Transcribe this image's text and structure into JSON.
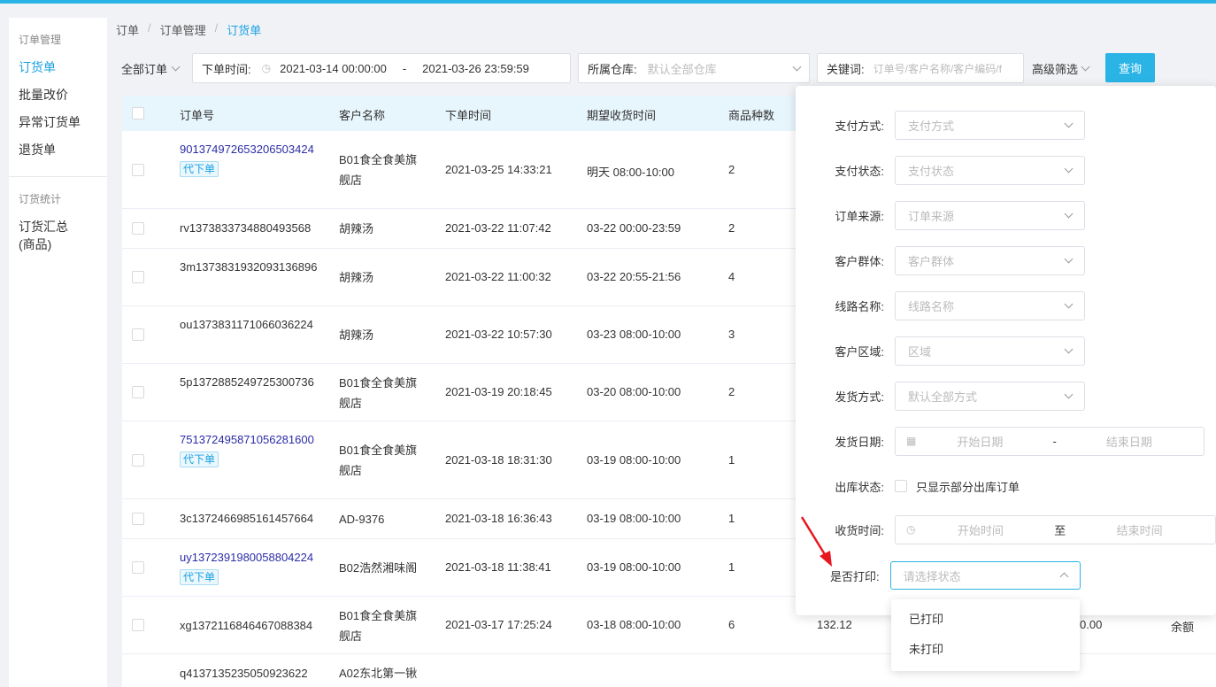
{
  "sidebar": {
    "group1_title": "订单管理",
    "items1": [
      "订货单",
      "批量改价",
      "异常订货单",
      "退货单"
    ],
    "group2_title": "订货统计",
    "items2": [
      "订货汇总(商品)"
    ]
  },
  "breadcrumb": [
    "订单",
    "订单管理",
    "订货单"
  ],
  "filters": {
    "order_scope": "全部订单",
    "date_label": "下单时间:",
    "date_start": "2021-03-14 00:00:00",
    "date_end": "2021-03-26 23:59:59",
    "warehouse_label": "所属仓库:",
    "warehouse_placeholder": "默认全部仓库",
    "keyword_label": "关键词:",
    "keyword_placeholder": "订单号/客户名称/客户编码/f",
    "advanced_label": "高级筛选",
    "query_button": "查询"
  },
  "table": {
    "headers": [
      "订单号",
      "客户名称",
      "下单时间",
      "期望收货时间",
      "商品种数"
    ],
    "rows": [
      {
        "order_no": "901374972653206503424",
        "tag": "代下单",
        "customer": "B01食全食美旗舰店",
        "order_time": "2021-03-25 14:33:21",
        "expected": "明天 08:00-10:00",
        "count": "2"
      },
      {
        "order_no": "rv1373833734880493568",
        "tag": "",
        "customer": "胡辣汤",
        "order_time": "2021-03-22 11:07:42",
        "expected": "03-22 00:00-23:59",
        "count": "2"
      },
      {
        "order_no": "3m1373831932093136896",
        "tag": "",
        "customer": "胡辣汤",
        "order_time": "2021-03-22 11:00:32",
        "expected": "03-22 20:55-21:56",
        "count": "4"
      },
      {
        "order_no": "ou1373831171066036224",
        "tag": "",
        "customer": "胡辣汤",
        "order_time": "2021-03-22 10:57:30",
        "expected": "03-23 08:00-10:00",
        "count": "3"
      },
      {
        "order_no": "5p1372885249725300736",
        "tag": "",
        "customer": "B01食全食美旗舰店",
        "order_time": "2021-03-19 20:18:45",
        "expected": "03-20 08:00-10:00",
        "count": "2"
      },
      {
        "order_no": "751372495871056281600",
        "tag": "代下单",
        "customer": "B01食全食美旗舰店",
        "order_time": "2021-03-18 18:31:30",
        "expected": "03-19 08:00-10:00",
        "count": "1"
      },
      {
        "order_no": "3c1372466985161457664",
        "tag": "",
        "customer": "AD-9376",
        "order_time": "2021-03-18 16:36:43",
        "expected": "03-19 08:00-10:00",
        "count": "1"
      },
      {
        "order_no": "uy1372391980058804224",
        "tag": "代下单",
        "customer": "B02浩然湘味阁",
        "order_time": "2021-03-18 11:38:41",
        "expected": "03-19 08:00-10:00",
        "count": "1"
      },
      {
        "order_no": "xg1372116846467088384",
        "tag": "",
        "customer": "B01食全食美旗舰店",
        "order_time": "2021-03-17 17:25:24",
        "expected": "03-18 08:00-10:00",
        "count": "6",
        "amount": "132.12",
        "amount2": "0.00",
        "pay": "余额"
      },
      {
        "order_no": "q4137135235050923622",
        "tag": "",
        "customer": "A02东北第一锹",
        "order_time": "",
        "expected": "",
        "count": ""
      }
    ]
  },
  "advanced": {
    "fields": [
      {
        "label": "支付方式:",
        "placeholder": "支付方式"
      },
      {
        "label": "支付状态:",
        "placeholder": "支付状态"
      },
      {
        "label": "订单来源:",
        "placeholder": "订单来源"
      },
      {
        "label": "客户群体:",
        "placeholder": "客户群体"
      },
      {
        "label": "线路名称:",
        "placeholder": "线路名称"
      },
      {
        "label": "客户区域:",
        "placeholder": "区域"
      },
      {
        "label": "发货方式:",
        "placeholder": "默认全部方式"
      }
    ],
    "ship_date_label": "发货日期:",
    "ship_date_start": "开始日期",
    "ship_date_sep": "-",
    "ship_date_end": "结束日期",
    "stock_label": "出库状态:",
    "stock_check": "只显示部分出库订单",
    "receive_label": "收货时间:",
    "receive_start": "开始时间",
    "receive_sep": "至",
    "receive_end": "结束时间",
    "print_label": "是否打印:",
    "print_placeholder": "请选择状态",
    "print_options": [
      "已打印",
      "未打印"
    ]
  },
  "colors": {
    "accent": "#2ab4e6",
    "link": "#2c2ca8",
    "danger": "#e0303a"
  }
}
